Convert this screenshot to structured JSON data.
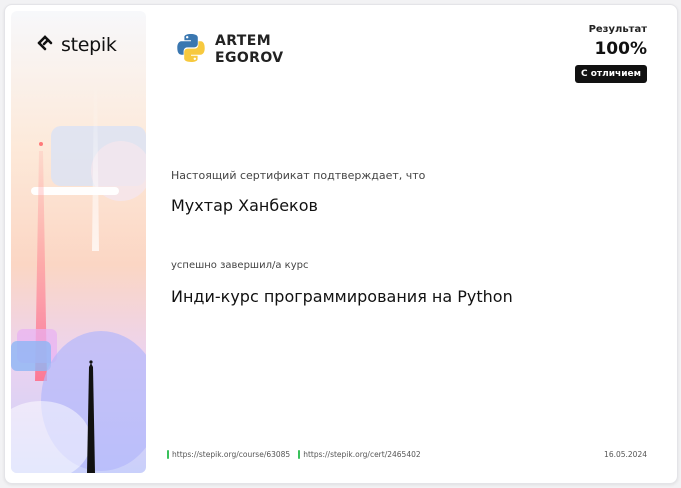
{
  "brand": {
    "name": "stepik",
    "logo_icon": "stepik-logo-icon"
  },
  "author": {
    "name_line1": "ARTEM",
    "name_line2": "EGOROV",
    "logo_icon": "python-logo-icon"
  },
  "result": {
    "label": "Результат",
    "value": "100%",
    "badge": "С отличием"
  },
  "certificate": {
    "intro": "Настоящий сертификат подтверждает, что",
    "student": "Мухтар Ханбеков",
    "completed": "успешно завершил/а  курс",
    "course": "Инди-курс программирования на Python"
  },
  "footer": {
    "course_link": "https://stepik.org/course/63085",
    "cert_link": "https://stepik.org/cert/2465402",
    "date": "16.05.2024"
  },
  "colors": {
    "accent_green": "#39c15b",
    "badge_bg": "#111111"
  }
}
